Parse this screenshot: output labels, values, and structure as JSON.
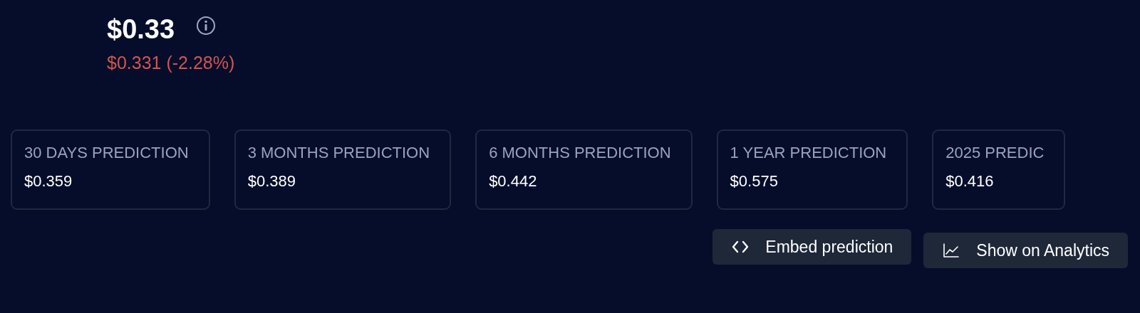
{
  "price": {
    "current": "$0.33",
    "previous": "$0.331",
    "change": "(-2.28%)"
  },
  "predictions": [
    {
      "label": "30 DAYS PREDICTION",
      "value": "$0.359"
    },
    {
      "label": "3 MONTHS PREDICTION",
      "value": "$0.389"
    },
    {
      "label": "6 MONTHS PREDICTION",
      "value": "$0.442"
    },
    {
      "label": "1 YEAR PREDICTION",
      "value": "$0.575"
    },
    {
      "label": "2025 PREDIC",
      "value": "$0.416"
    }
  ],
  "buttons": [
    {
      "kind": "embed",
      "label": "Embed prediction"
    },
    {
      "kind": "analytics",
      "label": "Show on Analytics"
    }
  ]
}
